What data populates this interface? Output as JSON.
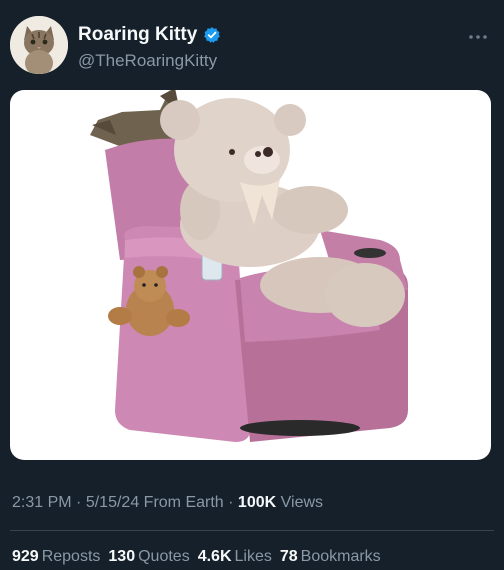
{
  "header": {
    "display_name": "Roaring Kitty",
    "handle": "@TheRoaringKitty",
    "verified_icon": "verified-badge-icon",
    "more_icon": "more-dots-icon",
    "accent_color": "#1d9bf0"
  },
  "media": {
    "content": "photo of teddy bear in pink recliner chair"
  },
  "meta": {
    "time": "2:31 PM",
    "sep1": "·",
    "date": "5/15/24",
    "source": "From Earth",
    "sep2": "·",
    "views_count": "100K",
    "views_label": "Views"
  },
  "stats": {
    "reposts_count": "929",
    "reposts_label": "Reposts",
    "quotes_count": "130",
    "quotes_label": "Quotes",
    "likes_count": "4.6K",
    "likes_label": "Likes",
    "bookmarks_count": "78",
    "bookmarks_label": "Bookmarks"
  }
}
